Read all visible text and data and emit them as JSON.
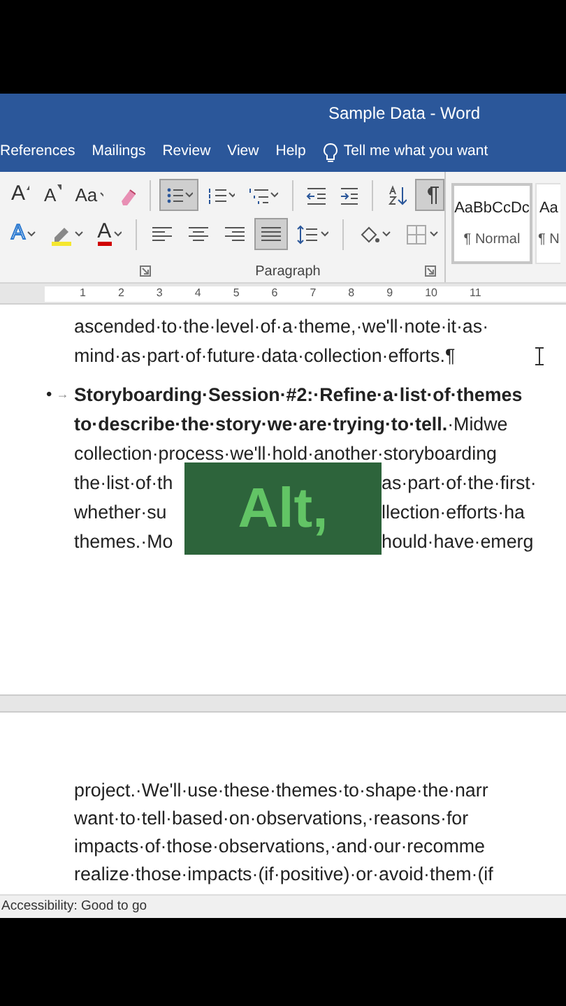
{
  "window": {
    "title": "Sample Data  -  Word"
  },
  "tabs": [
    {
      "label": "References",
      "selected": false
    },
    {
      "label": "Mailings",
      "selected": false
    },
    {
      "label": "Review",
      "selected": false
    },
    {
      "label": "View",
      "selected": false
    },
    {
      "label": "Help",
      "selected": false
    }
  ],
  "tell_me": {
    "placeholder": "Tell me what you want"
  },
  "ribbon": {
    "row_1": [
      {
        "kind": "grow-font",
        "label": "A",
        "selected": false
      },
      {
        "kind": "shrink-font",
        "label": "A",
        "selected": false
      },
      {
        "kind": "change-case",
        "label": "Aa",
        "selected": false
      },
      {
        "kind": "clear-format",
        "selected": false
      },
      {
        "kind": "sep"
      },
      {
        "kind": "bullets",
        "selected": true
      },
      {
        "kind": "numbering",
        "selected": false
      },
      {
        "kind": "multilevel",
        "selected": false
      },
      {
        "kind": "sep"
      },
      {
        "kind": "outdent",
        "selected": false
      },
      {
        "kind": "indent",
        "selected": false
      },
      {
        "kind": "sep"
      },
      {
        "kind": "sort",
        "selected": false
      },
      {
        "kind": "pilcrow",
        "selected": true
      }
    ],
    "row_2": [
      {
        "kind": "text-effects",
        "label": "A",
        "selected": false
      },
      {
        "kind": "highlight",
        "selected": false
      },
      {
        "kind": "font-color",
        "label": "A",
        "selected": false
      },
      {
        "kind": "sep"
      },
      {
        "kind": "align-left",
        "selected": false
      },
      {
        "kind": "align-center",
        "selected": false
      },
      {
        "kind": "align-right",
        "selected": false
      },
      {
        "kind": "justify",
        "selected": true
      },
      {
        "kind": "line-spacing",
        "selected": false
      },
      {
        "kind": "sep"
      },
      {
        "kind": "shading",
        "selected": false
      },
      {
        "kind": "borders",
        "selected": false
      }
    ],
    "group_label": "Paragraph",
    "styles": [
      {
        "sample": "AaBbCcDc",
        "name": "¶ Normal",
        "selected": true
      },
      {
        "sample": "Aa",
        "name": "¶ N",
        "selected": false
      }
    ]
  },
  "ruler": {
    "marks": [
      "1",
      "2",
      "3",
      "4",
      "5",
      "6",
      "7",
      "8",
      "9",
      "10",
      "11"
    ]
  },
  "page_1": {
    "lines": [
      {
        "kind": "text",
        "text": "ascended·to·the·level·of·a·theme,·we'll·note·it·as·"
      },
      {
        "kind": "text",
        "text": "mind·as·part·of·future·data·collection·efforts.¶"
      },
      {
        "kind": "bullet",
        "bullet": "•",
        "tab": "→",
        "text": "Storyboarding·Session·#2:·Refine·a·list·of·themes"
      },
      {
        "kind": "rich",
        "text": "**to·describe·the·story·we·are·trying·to·tell.**·Midwe"
      },
      {
        "kind": "text",
        "text": "collection·process·we'll·hold·another·storyboarding"
      },
      {
        "kind": "split",
        "left": "the·list·of·th",
        "right": "as·part·of·the·first·"
      },
      {
        "kind": "split",
        "left": "whether·su",
        "right": "llection·efforts·ha"
      },
      {
        "kind": "split",
        "left": "themes.·Mo",
        "right": "hould·have·emerg"
      }
    ]
  },
  "overlay": {
    "text": "Alt,"
  },
  "page_2": {
    "lines": [
      {
        "kind": "text",
        "text": "project.·We'll·use·these·themes·to·shape·the·narr"
      },
      {
        "kind": "text",
        "text": "want·to·tell·based·on·observations,·reasons·for"
      },
      {
        "kind": "text",
        "text": "impacts·of·those·observations,·and·our·recomme"
      },
      {
        "kind": "text",
        "text": "realize·those·impacts·(if·positive)·or·avoid·them·(if"
      }
    ]
  },
  "status_bar": {
    "text": "Accessibility: Good to go"
  }
}
